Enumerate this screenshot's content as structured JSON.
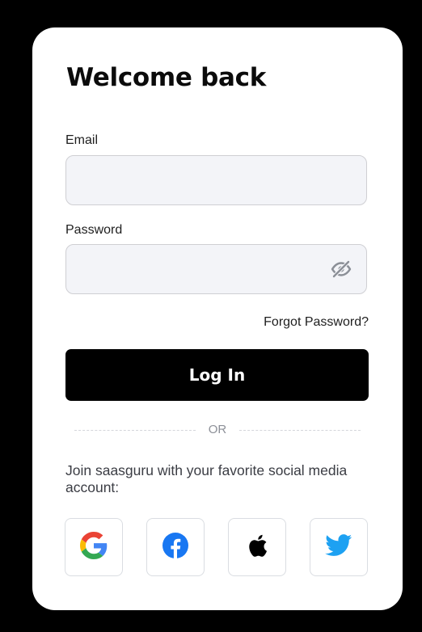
{
  "login": {
    "title": "Welcome back",
    "email_label": "Email",
    "email_value": "",
    "password_label": "Password",
    "password_value": "",
    "password_icon": "eye-off-icon",
    "forgot_label": "Forgot Password?",
    "login_label": "Log In",
    "divider_text": "OR",
    "social_prompt": "Join saasguru with your favorite social media account:",
    "social": [
      {
        "icon": "google-icon"
      },
      {
        "icon": "facebook-icon"
      },
      {
        "icon": "apple-icon"
      },
      {
        "icon": "twitter-icon"
      }
    ]
  },
  "colors": {
    "background": "#000000",
    "card": "#ffffff",
    "primary_button": "#000000",
    "input_fill": "#f3f4f8",
    "facebook": "#1877F2",
    "twitter": "#1DA1F2"
  }
}
